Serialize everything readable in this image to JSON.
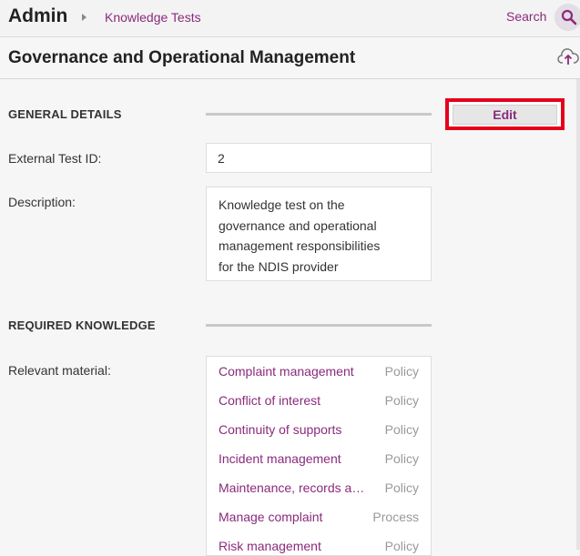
{
  "topbar": {
    "app_title": "Admin",
    "breadcrumb_link": "Knowledge Tests",
    "search_label": "Search"
  },
  "page": {
    "title": "Governance and Operational Management"
  },
  "general_details": {
    "heading": "GENERAL DETAILS",
    "edit_label": "Edit",
    "external_id_label": "External Test ID:",
    "external_id_value": "2",
    "description_label": "Description:",
    "description_lines": [
      "Knowledge test on the",
      "governance and operational",
      "management responsibilities",
      "for the NDIS provider"
    ]
  },
  "required_knowledge": {
    "heading": "REQUIRED KNOWLEDGE",
    "relevant_label": "Relevant material:",
    "materials": [
      {
        "name": "Complaint management",
        "type": "Policy"
      },
      {
        "name": "Conflict of interest",
        "type": "Policy"
      },
      {
        "name": "Continuity of supports",
        "type": "Policy"
      },
      {
        "name": "Incident management",
        "type": "Policy"
      },
      {
        "name": "Maintenance, records and information",
        "type": "Policy"
      },
      {
        "name": "Manage complaint",
        "type": "Process"
      },
      {
        "name": "Risk management",
        "type": "Policy"
      }
    ]
  },
  "colors": {
    "accent": "#8b2a7c",
    "highlight_border": "#e4001b"
  },
  "icons": {
    "breadcrumb_separator": "chevron-right-icon",
    "search": "search-icon",
    "upload": "upload-icon"
  }
}
